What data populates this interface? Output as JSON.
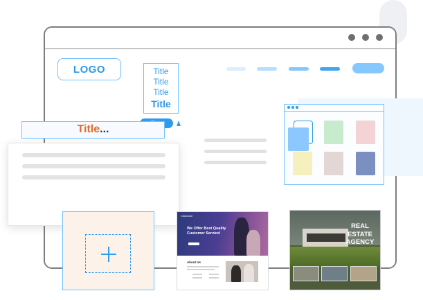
{
  "header": {
    "logo_label": "LOGO"
  },
  "title_variants": [
    "Title",
    "Title",
    "Title",
    "Title"
  ],
  "title_tag": "Title",
  "title_input": {
    "text": "Title",
    "ellipsis": "..."
  },
  "web_template": {
    "brand": "ClickCare",
    "headline": "We Offer Best Quality Customer Service!",
    "section_title": "About Us"
  },
  "estate_template": {
    "headline_lines": [
      "REAL",
      "ESTATE",
      "AGENCY"
    ]
  },
  "colors": {
    "accent": "#2f9bec",
    "accent_light": "#6fc1ff",
    "title_orange": "#e26a2c",
    "tile_green": "#c8ebce",
    "tile_pink": "#f3d3d6",
    "tile_yellow": "#f6efbe",
    "tile_mauve": "#e3d7d5",
    "tile_navy": "#7b8fc0"
  }
}
